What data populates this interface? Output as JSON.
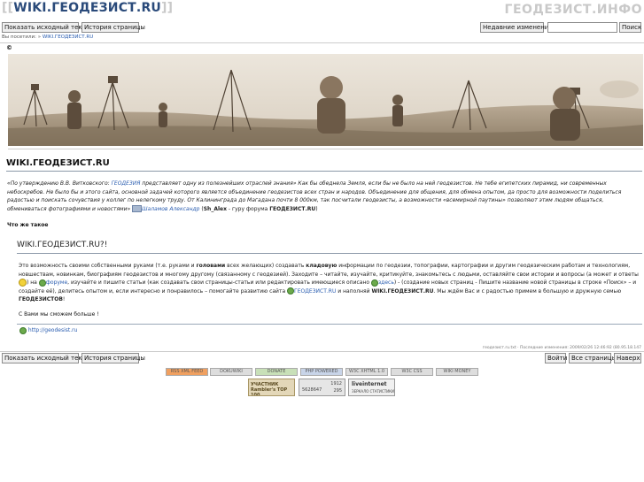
{
  "header": {
    "site_title": "WIKI.ГЕОДЕЗИСТ.RU",
    "brand": "ГЕОДЕЗИСТ.ИНФО"
  },
  "toolbar_top": {
    "show_source": "Показать исходный текст",
    "history": "История страницы",
    "recent_changes": "Недавние изменения",
    "search_button": "Поиск",
    "search_value": ""
  },
  "breadcrumb": {
    "prefix": "Вы посетили:",
    "page": "WIKI.ГЕОДЕЗИСТ.RU"
  },
  "copyright": "©",
  "page_title": "WIKI.ГЕОДЕЗИСТ.RU",
  "quote": {
    "p1": "«По утверждению В.В. Витковского:",
    "link1": "ГЕОДЕЗИЯ",
    "p2": "представляет одну из полезнейших отраслей знания»   Как бы обеднела Земля, если бы не было на ней геодезистов. Не тебе египетских пирамид, ни современных небоскребов. Не было бы и этого сайта, основной задачей которого является объединение геодезистов всех стран и народов. Объединение для общения, для обмена опытом, да просто для возможности поделиться радостью и поискать сочувствия у коллег по нелегкому труду.  От Калининграда до Магадана почти 8 000км, так посчитали геодезисты, а возможности «всемирной паутины» позволяют этим людям общаться, обмениваться фотографиями и новостями»",
    "author_link": "Шаламов Александр",
    "author_rest_1": "(",
    "author_nick": "Sh_Alex",
    "author_rest_2": " - гуру форума ",
    "author_forum": "ГЕОДЕЗИСТ.RU",
    "author_rest_3": ")"
  },
  "what_is": "Что же такое",
  "section": {
    "heading": "WIKI.ГЕОДЕЗИСТ.RU?!",
    "para1_a": "Это возможность своими собственными руками (т.е. руками и ",
    "para1_b": "головами",
    "para1_c": " всех желающих) создавать ",
    "para1_d": "кладовую",
    "para1_e": " информации по геодезии, топографии, картографии и другим геодезическим работам и технологиям, новшествам, новинкам, биографиям геодезистов и многому другому (связанному с геодезией). Заходите – читайте, изучайте, критикуйте, знакомьтесь с людьми, оставляйте свои истории и вопросы (а может и ответы",
    "para1_f": ") на ",
    "forum_link": "форуме",
    "para1_g": ", изучайте и пишите статьи (как создавать свои страницы-статьи или редактировать имеющиеся описано ",
    "here_link": "здесь",
    "para1_h": ") - (создание новых страниц - Пишите название новой страницы в строке «Поиск» – и создайте её), делитесь опытом и, если интересно и понравилось – помогайте развитию сайта ",
    "site_link": "ГЕОДЕЗИСТ.RU",
    "para1_i": " и наполняй ",
    "site_bold": "WIKI.ГЕОДЕЗИСТ.RU",
    "para1_j": ". Мы ждём Вас и с радостью примем в большую и дружную семью ",
    "family": "ГЕОДЕЗИСТОВ",
    "para1_k": "!",
    "para2": "С Вами мы сможем больше !",
    "url": "http://geodesist.ru"
  },
  "footer_meta": "геодезист.ru.txt · Последние изменения: 2009/02/26 12:46:92 (80.95.18.147",
  "toolbar_bottom": {
    "show_source": "Показать исходный текст",
    "history": "История страницы",
    "login": "Войти",
    "all_pages": "Все страницы",
    "up": "Наверх"
  },
  "badges": [
    {
      "text": "RSS  XML FEED",
      "color": "#f0a060"
    },
    {
      "text": "DOKUWIKI",
      "color": "#dddddd"
    },
    {
      "text": "DONATE",
      "color": "#c8e0b8"
    },
    {
      "text": "PHP POWERED",
      "color": "#c8d4e8"
    },
    {
      "text": "W3C XHTML 1.0",
      "color": "#dddddd"
    },
    {
      "text": "W3C CSS",
      "color": "#dddddd"
    },
    {
      "text": "WIKI MONEY",
      "color": "#dddddd"
    }
  ],
  "counters": {
    "rambler_label": "УЧАСТНИК Rambler's TOP 100",
    "counter_a": "5628647",
    "counter_b1": "1912",
    "counter_b2": "295",
    "liveinternet": "liveinternet",
    "liveinternet_sub": "ЗЕРКАЛО СТАТИСТИКИ"
  }
}
